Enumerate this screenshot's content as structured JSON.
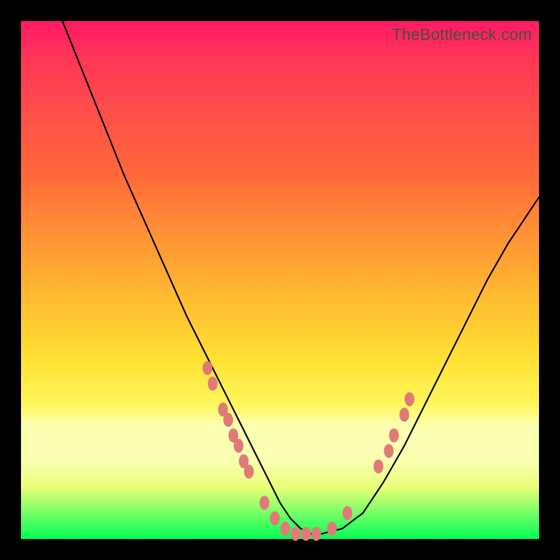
{
  "watermark": "TheBottleneck.com",
  "colors": {
    "dot": "#e07a78",
    "curve": "#000000",
    "frame": "#000000"
  },
  "chart_data": {
    "type": "line",
    "title": "",
    "xlabel": "",
    "ylabel": "",
    "xlim": [
      0,
      100
    ],
    "ylim": [
      0,
      100
    ],
    "note": "Axes unlabeled; values estimated from pixel positions on a 0–100 normalized scale (x left→right, y bottom→top).",
    "series": [
      {
        "name": "bottleneck-curve",
        "x": [
          8,
          12,
          16,
          20,
          24,
          28,
          32,
          36,
          40,
          42,
          44,
          46,
          48,
          50,
          52,
          54,
          56,
          58,
          62,
          66,
          70,
          74,
          78,
          82,
          86,
          90,
          94,
          98,
          100
        ],
        "y": [
          100,
          90,
          80,
          70,
          61,
          52,
          43,
          35,
          27,
          23,
          19,
          15,
          11,
          7,
          4,
          2,
          1,
          1,
          2,
          5,
          11,
          18,
          26,
          34,
          42,
          50,
          57,
          63,
          66
        ]
      }
    ],
    "highlight_points": {
      "name": "salmon-dots",
      "points": [
        {
          "x": 36,
          "y": 33
        },
        {
          "x": 37,
          "y": 30
        },
        {
          "x": 39,
          "y": 25
        },
        {
          "x": 40,
          "y": 23
        },
        {
          "x": 41,
          "y": 20
        },
        {
          "x": 42,
          "y": 18
        },
        {
          "x": 43,
          "y": 15
        },
        {
          "x": 44,
          "y": 13
        },
        {
          "x": 47,
          "y": 7
        },
        {
          "x": 49,
          "y": 4
        },
        {
          "x": 51,
          "y": 2
        },
        {
          "x": 53,
          "y": 1
        },
        {
          "x": 55,
          "y": 1
        },
        {
          "x": 57,
          "y": 1
        },
        {
          "x": 60,
          "y": 2
        },
        {
          "x": 63,
          "y": 5
        },
        {
          "x": 69,
          "y": 14
        },
        {
          "x": 71,
          "y": 17
        },
        {
          "x": 72,
          "y": 20
        },
        {
          "x": 74,
          "y": 24
        },
        {
          "x": 75,
          "y": 27
        }
      ]
    }
  }
}
